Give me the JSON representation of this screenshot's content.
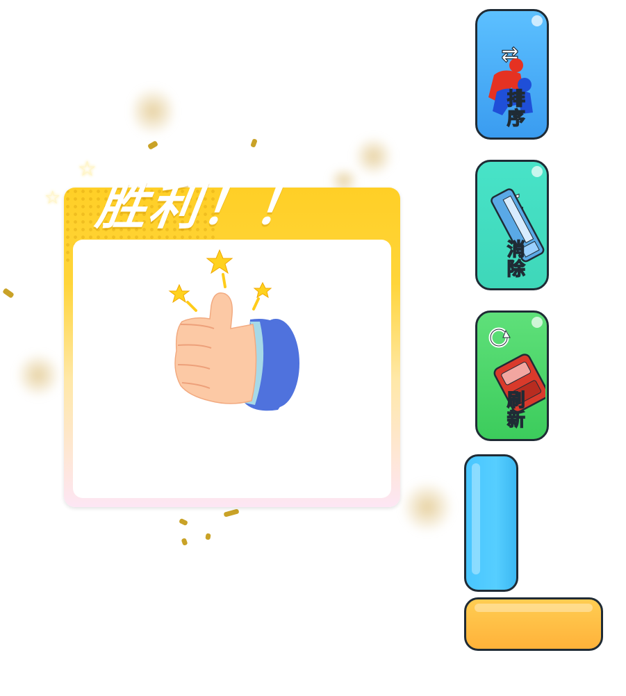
{
  "victory": {
    "title": "胜利！！"
  },
  "side_buttons": [
    {
      "label": "排序",
      "icon": "sort-people-icon",
      "color": "#4aa9f5"
    },
    {
      "label": "消除",
      "icon": "vip-bus-icon",
      "badge": "vip",
      "color": "#45dfc3"
    },
    {
      "label": "刷新",
      "icon": "refresh-car-icon",
      "color": "#4cd66b"
    }
  ],
  "colors": {
    "panel_top": "#ffcf26",
    "panel_bottom": "#fde6f4",
    "blue_block": "#4fc9ff",
    "yellow_block": "#ffbe45"
  }
}
